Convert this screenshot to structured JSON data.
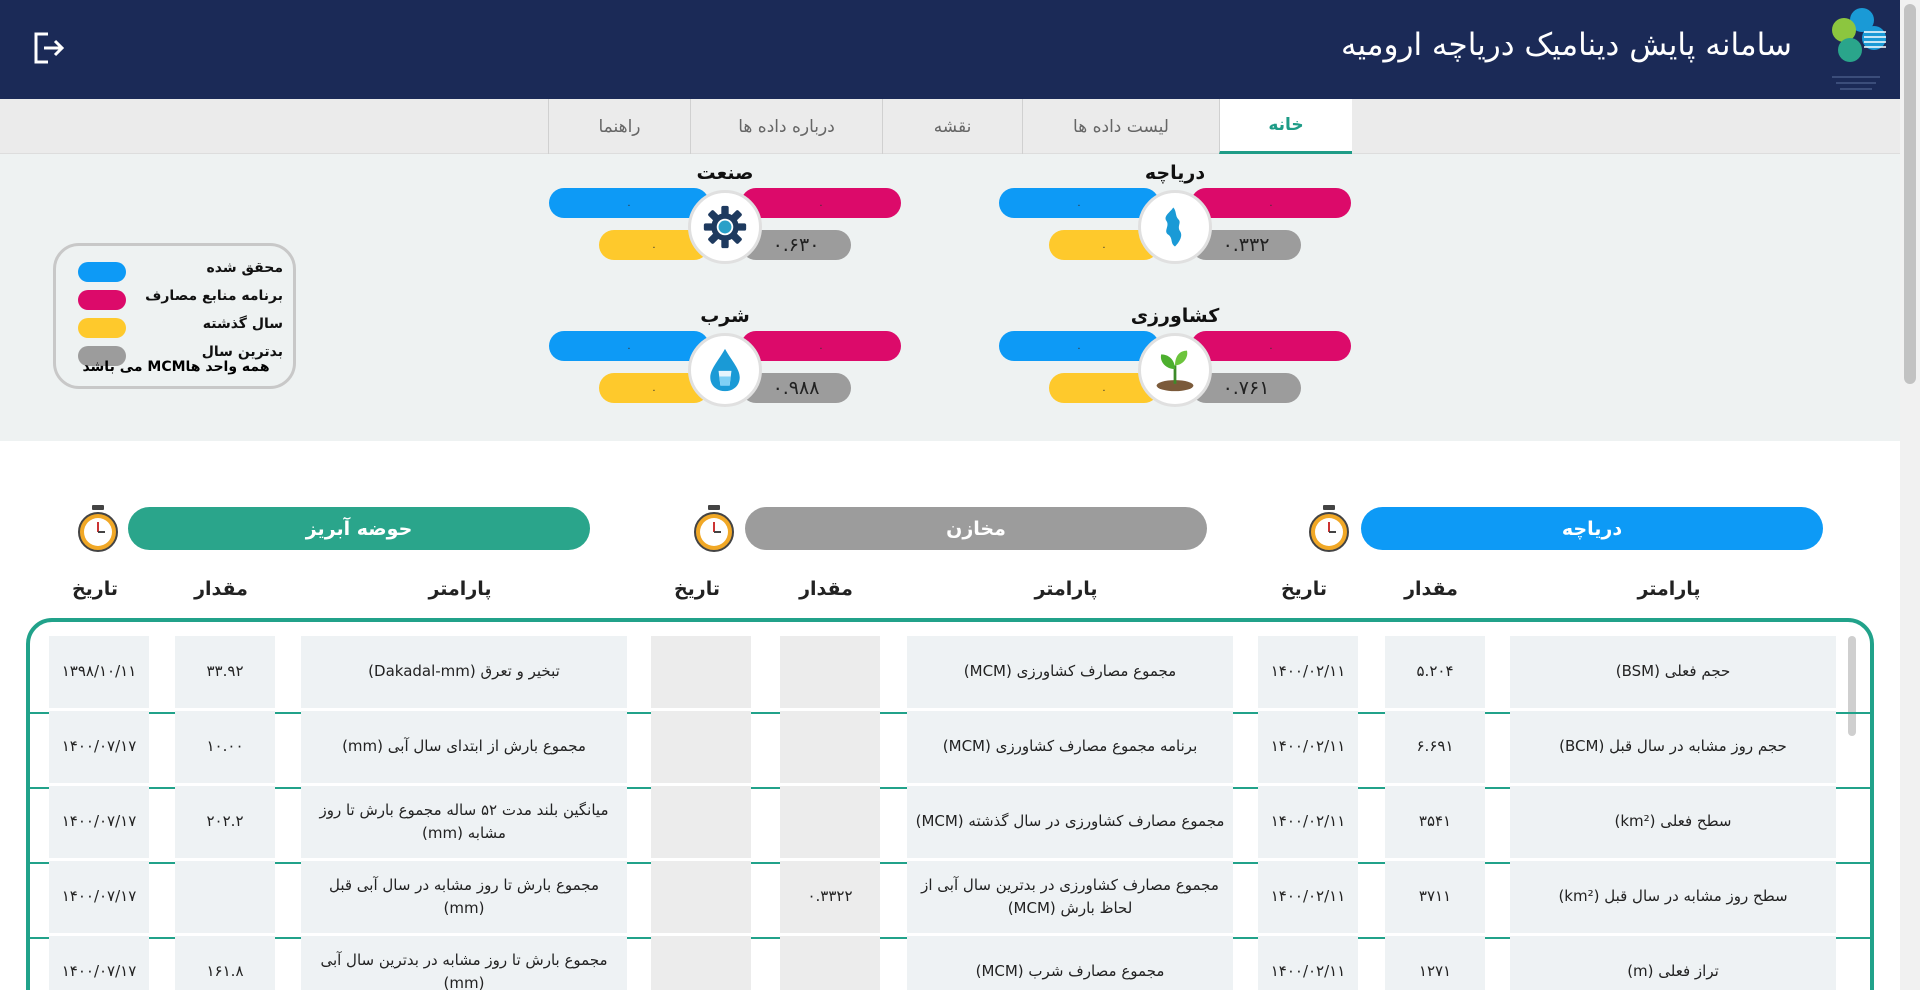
{
  "header": {
    "title": "سامانه پایش دینامیک دریاچه ارومیه"
  },
  "tabs": [
    {
      "label": "خانه",
      "active": true
    },
    {
      "label": "لیست داده ها",
      "active": false
    },
    {
      "label": "نقشه",
      "active": false
    },
    {
      "label": "درباره داده ها",
      "active": false
    },
    {
      "label": "راهنما",
      "active": false
    }
  ],
  "cards": {
    "lake": {
      "title": "دریاچه",
      "blue": ".",
      "red": ".",
      "yellow": ".",
      "gray": "۰.۳۳۲",
      "icon": "lake-map-icon"
    },
    "industry": {
      "title": "صنعت",
      "blue": ".",
      "red": ".",
      "yellow": ".",
      "gray": "۰.۶۳۰",
      "icon": "gear-icon"
    },
    "agriculture": {
      "title": "کشاورزی",
      "blue": ".",
      "red": ".",
      "yellow": ".",
      "gray": "۰.۷۶۱",
      "icon": "plant-icon"
    },
    "drinking": {
      "title": "شرب",
      "blue": ".",
      "red": ".",
      "yellow": ".",
      "gray": "۰.۹۸۸",
      "icon": "water-drop-icon"
    }
  },
  "legend": {
    "items": [
      {
        "label": "محقق شده",
        "color": "#0d9af6"
      },
      {
        "label": "برنامه منابع مصارف",
        "color": "#dc0a6a"
      },
      {
        "label": "سال گذشته",
        "color": "#fec92c"
      },
      {
        "label": "بدترین سال",
        "color": "#9c9c9c"
      }
    ],
    "note": "همه واحد هاMCM می باشد"
  },
  "sections": {
    "lake": {
      "label": "دریاچه",
      "color": "#0d9af6"
    },
    "reservoirs": {
      "label": "مخازن",
      "color": "#9c9c9c"
    },
    "basin": {
      "label": "حوضه آبریز",
      "color": "#2aa58b"
    }
  },
  "columns": {
    "param": "پارامتر",
    "value": "مقدار",
    "date": "تاریخ"
  },
  "table": {
    "lake": [
      {
        "param": "حجم فعلی (BSM)",
        "value": "۵.۲۰۴",
        "date": "۱۴۰۰/۰۲/۱۱"
      },
      {
        "param": "حجم روز مشابه در سال قبل (BCM)",
        "value": "۶.۶۹۱",
        "date": "۱۴۰۰/۰۲/۱۱"
      },
      {
        "param": "سطح فعلی (km²)",
        "value": "۳۵۴۱",
        "date": "۱۴۰۰/۰۲/۱۱"
      },
      {
        "param": "سطح روز مشابه در سال قبل (km²)",
        "value": "۳۷۱۱",
        "date": "۱۴۰۰/۰۲/۱۱"
      },
      {
        "param": "تراز فعلی (m)",
        "value": "۱۲۷۱",
        "date": "۱۴۰۰/۰۲/۱۱"
      }
    ],
    "reservoirs": [
      {
        "param": "مجموع مصارف کشاورزی (MCM)",
        "value": "",
        "date": ""
      },
      {
        "param": "برنامه مجموع مصارف کشاورزی (MCM)",
        "value": "",
        "date": ""
      },
      {
        "param": "مجموع مصارف کشاورزی در سال گذشته (MCM)",
        "value": "",
        "date": ""
      },
      {
        "param": "مجموع مصارف کشاورزی در بدترین سال آبی از لحاظ بارش (MCM)",
        "value": "۰.۳۳۲۲",
        "date": ""
      },
      {
        "param": "مجموع مصارف شرب (MCM)",
        "value": "",
        "date": ""
      }
    ],
    "basin": [
      {
        "param": "تبخیر و تعرق (Dakadal-mm)",
        "value": "۳۳.۹۲",
        "date": "۱۳۹۸/۱۰/۱۱"
      },
      {
        "param": "مجموع بارش از ابتدای سال آبی (mm)",
        "value": "۱۰.۰۰",
        "date": "۱۴۰۰/۰۷/۱۷"
      },
      {
        "param": "میانگین بلند مدت ۵۲ ساله مجموع بارش تا روز مشابه (mm)",
        "value": "۲۰۲.۲",
        "date": "۱۴۰۰/۰۷/۱۷"
      },
      {
        "param": "مجموع بارش تا روز مشابه در سال آبی قبل (mm)",
        "value": "",
        "date": "۱۴۰۰/۰۷/۱۷"
      },
      {
        "param": "مجموع بارش تا روز مشابه در بدترین سال آبی (mm)",
        "value": "۱۶۱.۸",
        "date": "۱۴۰۰/۰۷/۱۷"
      }
    ]
  }
}
